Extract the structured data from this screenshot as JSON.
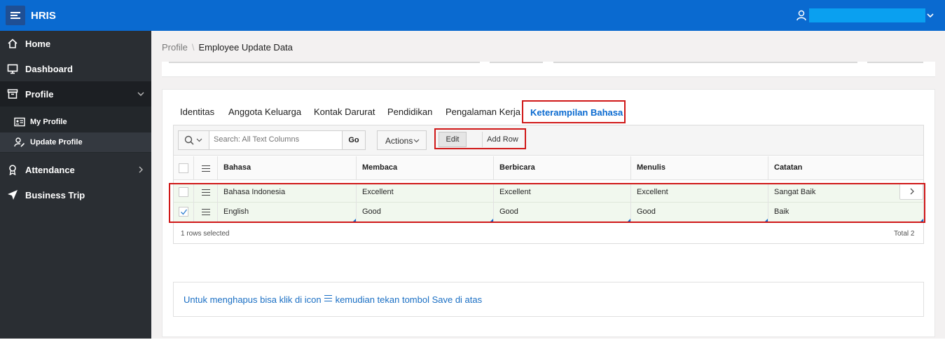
{
  "app": {
    "title": "HRIS"
  },
  "sidebar": {
    "items": [
      {
        "label": "Home",
        "icon": "home-icon"
      },
      {
        "label": "Dashboard",
        "icon": "monitor-icon"
      },
      {
        "label": "Profile",
        "icon": "archive-box-icon",
        "expanded": true
      },
      {
        "label": "Attendance",
        "icon": "medal-icon"
      },
      {
        "label": "Business Trip",
        "icon": "plane-icon"
      }
    ],
    "profile_subitems": [
      {
        "label": "My Profile",
        "icon": "id-card-icon"
      },
      {
        "label": "Update Profile",
        "icon": "user-edit-icon",
        "current": true
      }
    ]
  },
  "breadcrumb": {
    "parent": "Profile",
    "current": "Employee Update Data"
  },
  "tabs": [
    "Identitas",
    "Anggota Keluarga",
    "Kontak Darurat",
    "Pendidikan",
    "Pengalaman Kerja",
    "Keterampilan Bahasa"
  ],
  "active_tab": "Keterampilan Bahasa",
  "toolbar": {
    "search_placeholder": "Search: All Text Columns",
    "go_label": "Go",
    "actions_label": "Actions",
    "edit_label": "Edit",
    "add_row_label": "Add Row"
  },
  "grid": {
    "columns": [
      "Bahasa",
      "Membaca",
      "Berbicara",
      "Menulis",
      "Catatan"
    ],
    "rows": [
      {
        "selected": false,
        "cells": [
          "Bahasa Indonesia",
          "Excellent",
          "Excellent",
          "Excellent",
          "Sangat Baik"
        ]
      },
      {
        "selected": true,
        "cells": [
          "English",
          "Good",
          "Good",
          "Good",
          "Baik"
        ]
      }
    ],
    "footer_selected": "1 rows selected",
    "footer_total": "Total 2"
  },
  "note": {
    "before": "Untuk menghapus bisa klik di icon",
    "after": "kemudian tekan tombol Save di atas"
  },
  "colors": {
    "topbar": "#0a6ad0",
    "sidebar": "#2a2e33",
    "highlight": "#d01818",
    "link": "#1a6fc4"
  }
}
